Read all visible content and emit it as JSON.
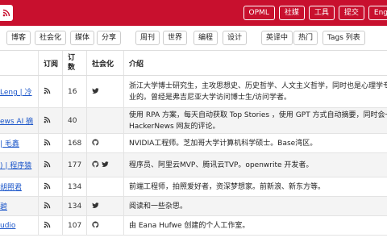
{
  "topbar": {
    "logo_icon": "rss-icon",
    "nav": [
      "OPML",
      "社媒",
      "工具",
      "提交",
      "Eng"
    ]
  },
  "filters": {
    "categories": [
      "博客",
      "社会化",
      "媒体",
      "分享"
    ],
    "lists": [
      "周刊",
      "世界",
      "编程",
      "设计"
    ],
    "views": [
      "英译中",
      "热门",
      "Tags 列表"
    ]
  },
  "table": {
    "headers": {
      "subscribe": "订阅",
      "count": "订\n数",
      "social": "社会化",
      "intro": "介绍"
    },
    "rows": [
      {
        "name": "Leng | 冷",
        "count": "16",
        "social_icons": [
          "twitter-icon"
        ],
        "desc_lines": [
          "浙江大学博士研究生，主攻思想史、历史哲学、人文主义哲学，同时也是心理学专",
          "业的。曾经是弗吉尼亚大学访问博士生/访问学者。"
        ]
      },
      {
        "name": "ews AI 摘",
        "count": "40",
        "social_icons": [],
        "desc_lines": [
          "使用 RPA 方案，每天自动获取 Top Stories ，使用 GPT 方式自动摘要，同时会一",
          "HackerNews 网友的评论。"
        ]
      },
      {
        "name": "| 毛鑫",
        "count": "168",
        "social_icons": [
          "github-icon"
        ],
        "desc_lines": [
          "NVIDIA工程师。芝加哥大学计算机科学硕士。Base湾区。"
        ]
      },
      {
        "name": ") | 程序猿",
        "count": "177",
        "social_icons": [
          "github-icon",
          "twitter-icon"
        ],
        "desc_lines": [
          "程序员、阿里云MVP、腾讯云TVP。openwrite 开发者。"
        ]
      },
      {
        "name": "胡照君",
        "count": "134",
        "social_icons": [],
        "desc_lines": [
          "前端工程师，拍照爱好者，资深梦想家。前新浪、新东方等。"
        ]
      },
      {
        "name": "碧",
        "count": "134",
        "social_icons": [
          "twitter-icon"
        ],
        "desc_lines": [
          "阅读和一些杂思。"
        ]
      },
      {
        "name": "udio",
        "count": "107",
        "social_icons": [
          "github-icon"
        ],
        "desc_lines": [
          "由 Eana Hufwe 创建的个人工作室。"
        ]
      }
    ]
  },
  "colors": {
    "brand_red": "#c8102e",
    "link_blue": "#1a55c9",
    "rss_orange": "#333333"
  }
}
